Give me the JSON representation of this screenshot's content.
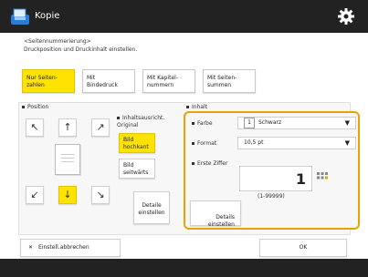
{
  "titlebar": {
    "title": "Kopie",
    "app_icon": "copy-icon",
    "settings_icon": "gear-icon"
  },
  "header": {
    "line1": "<Seitennummerierung>",
    "line2": "Druckposition und Druckinhalt einstellen."
  },
  "tabs": [
    {
      "label": "Nur Seiten-\nzahlen",
      "active": true
    },
    {
      "label": "Mit\nBindedruck",
      "active": false
    },
    {
      "label": "Mit Kapitel-\nnummern",
      "active": false
    },
    {
      "label": "Mit Seiten-\nsummen",
      "active": false
    }
  ],
  "position": {
    "label": "Position",
    "arrows": {
      "up_left": "↖",
      "up": "↑",
      "up_right": "↗",
      "down_left": "↙",
      "down": "↓",
      "down_right": "↘"
    },
    "selected": "down"
  },
  "orientation": {
    "label": "Inhaltsausricht. Original",
    "portrait": "Bild\nhochkant",
    "landscape": "Bild\nseitwärts",
    "details": "Detaile\neinstellen"
  },
  "content": {
    "label": "Inhalt",
    "color_label": "Farbe",
    "color_value_num": "1",
    "color_value": "Schwarz",
    "format_label": "Format",
    "format_value": "10,5 pt",
    "start_label": "Erste Ziffer",
    "start_value": "1",
    "range": "(1-99999)",
    "details": "Details\neinstellen"
  },
  "footer": {
    "cancel": "Einstell.abbrechen",
    "ok": "OK"
  },
  "colors": {
    "accent": "#ffe300",
    "highlight_border": "#e8a300",
    "bar": "#222222"
  }
}
